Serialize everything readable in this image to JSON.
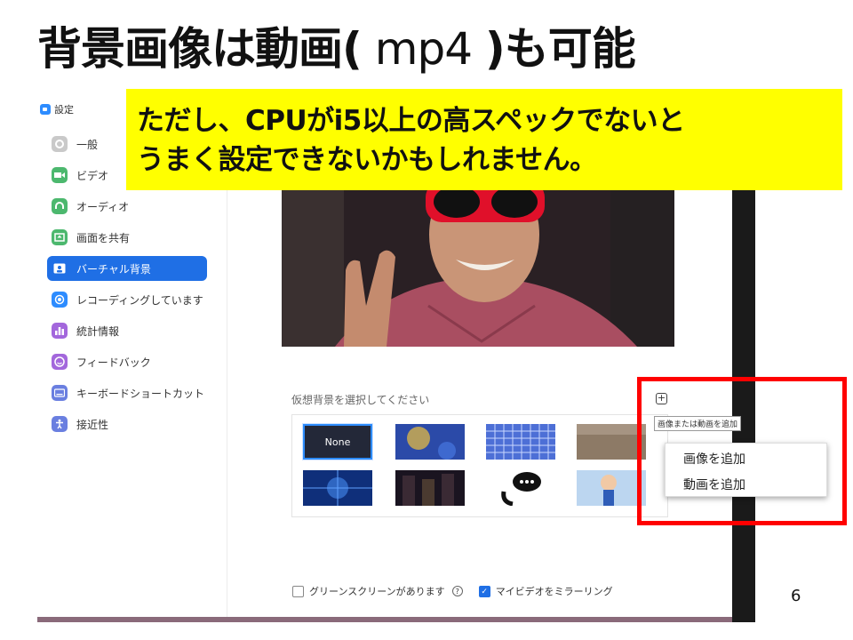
{
  "slide": {
    "title_main": "背景画像は動画(",
    "title_mp4": " mp4 ",
    "title_end": ")も可能",
    "page_number": "6"
  },
  "banner": {
    "line1": "ただし、CPUがi5以上の高スペックでないと",
    "line2": "うまく設定できないかもしれません。"
  },
  "window": {
    "title": "設定",
    "sidebar": [
      {
        "label": "一般",
        "icon": "gear-icon",
        "color": "#c9c9c9"
      },
      {
        "label": "ビデオ",
        "icon": "video-icon",
        "color": "#4cb86e"
      },
      {
        "label": "オーディオ",
        "icon": "headphones-icon",
        "color": "#4cb86e"
      },
      {
        "label": "画面を共有",
        "icon": "share-screen-icon",
        "color": "#4cb86e"
      },
      {
        "label": "バーチャル背景",
        "icon": "virtual-background-icon",
        "color": "#ffffff",
        "active": true
      },
      {
        "label": "レコーディングしています",
        "icon": "record-icon",
        "color": "#2d8cff"
      },
      {
        "label": "統計情報",
        "icon": "stats-icon",
        "color": "#a367dc"
      },
      {
        "label": "フィードバック",
        "icon": "feedback-icon",
        "color": "#a367dc"
      },
      {
        "label": "キーボードショートカット",
        "icon": "keyboard-icon",
        "color": "#6a7fe0"
      },
      {
        "label": "接近性",
        "icon": "accessibility-icon",
        "color": "#6a7fe0"
      }
    ],
    "select_label": "仮想背景を選択してください",
    "none_thumb": "None",
    "add_tooltip": "画像または動画を追加",
    "add_menu": [
      "画像を追加",
      "動画を追加"
    ],
    "green_screen_label": "グリーンスクリーンがあります",
    "mirror_label": "マイビデオをミラーリング",
    "mirror_checked": true,
    "green_screen_checked": false
  },
  "colors": {
    "banner": "#ffff00",
    "highlight_box": "#ff0000",
    "active_item": "#1f6fe5"
  }
}
